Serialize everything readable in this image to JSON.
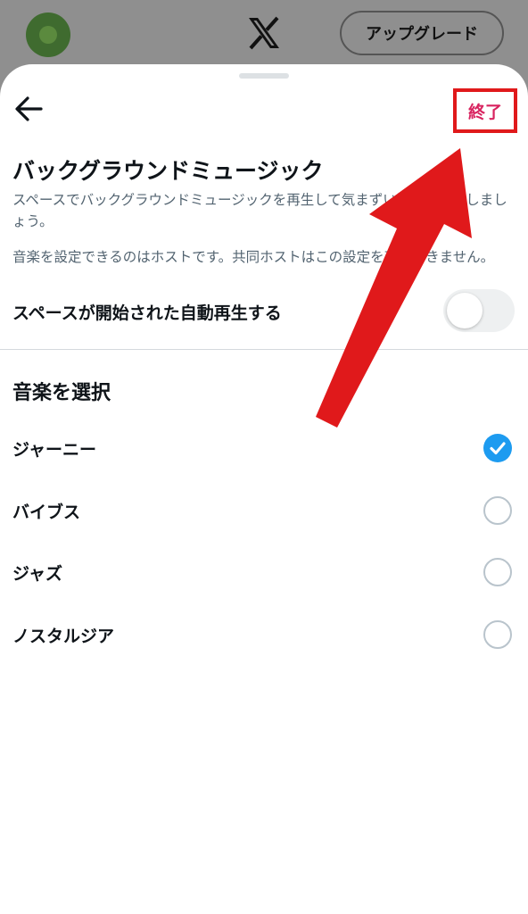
{
  "header": {
    "upgrade_label": "アップグレード"
  },
  "sheet": {
    "done_label": "終了",
    "title": "バックグラウンドミュージック",
    "description1": "スペースでバックグラウンドミュージックを再生して気まずい沈黙を解消しましょう。",
    "description2": "音楽を設定できるのはホストです。共同ホストはこの設定を変更できません。",
    "autoplay": {
      "label": "スペースが開始された自動再生する",
      "enabled": false
    },
    "music_section_title": "音楽を選択",
    "options": [
      {
        "label": "ジャーニー",
        "selected": true
      },
      {
        "label": "バイブス",
        "selected": false
      },
      {
        "label": "ジャズ",
        "selected": false
      },
      {
        "label": "ノスタルジア",
        "selected": false
      }
    ]
  },
  "colors": {
    "accent": "#1d9bf0",
    "done": "#d8235f",
    "annotation": "#e0191b"
  },
  "icons": {
    "back": "arrow-left-icon",
    "logo": "x-logo-icon",
    "check": "check-icon"
  }
}
